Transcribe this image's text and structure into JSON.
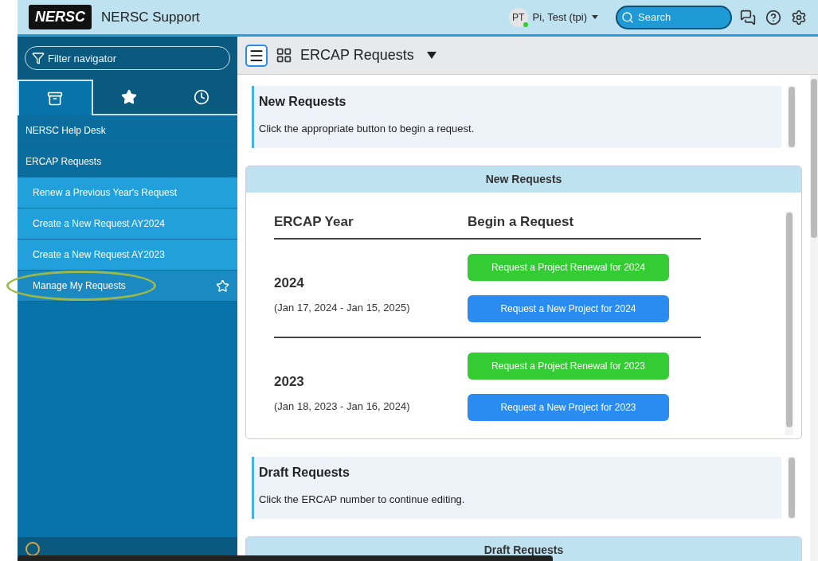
{
  "header": {
    "logo": "NERSC",
    "title": "NERSC Support",
    "user_initials": "PT",
    "user_name": "Pi, Test (tpi)",
    "search": {
      "placeholder": "Search"
    }
  },
  "sidebar": {
    "filter": {
      "placeholder": "Filter navigator"
    },
    "tabs": [
      {
        "kind": "archive",
        "selected": true
      },
      {
        "kind": "star",
        "selected": false
      },
      {
        "kind": "clock",
        "selected": false
      }
    ],
    "items": [
      {
        "label": "NERSC Help Desk",
        "kind": "group",
        "selected": false
      },
      {
        "label": "ERCAP Requests",
        "kind": "group",
        "selected": false
      },
      {
        "label": "Renew a Previous Year's Request",
        "kind": "link",
        "selected": false
      },
      {
        "label": "Create a New Request AY2024",
        "kind": "link",
        "selected": false
      },
      {
        "label": "Create a New Request AY2023",
        "kind": "link",
        "selected": false
      },
      {
        "label": "Manage My Requests",
        "kind": "link",
        "selected": true
      }
    ]
  },
  "toolbar": {
    "title": "ERCAP Requests"
  },
  "sections": [
    {
      "kind": "note",
      "title": "New Requests",
      "text": "Click the appropriate button to begin a request."
    },
    {
      "kind": "panel",
      "title": "New Requests",
      "columns": [
        "ERCAP Year",
        "Begin a Request"
      ],
      "rows": [
        {
          "year": "2024",
          "range": "(Jan 17, 2024 - Jan 15, 2025)",
          "buttons": [
            {
              "label": "Request a Project Renewal for 2024",
              "kind": "renew"
            },
            {
              "label": "Request a New Project for 2024",
              "kind": "new"
            }
          ]
        },
        {
          "year": "2023",
          "range": "(Jan 18, 2023 - Jan 16, 2024)",
          "buttons": [
            {
              "label": "Request a Project Renewal for 2023",
              "kind": "renew"
            },
            {
              "label": "Request a New Project for 2023",
              "kind": "new"
            }
          ]
        }
      ]
    },
    {
      "kind": "note",
      "title": "Draft Requests",
      "text": "Click the ERCAP number to continue editing."
    },
    {
      "kind": "panel",
      "title": "Draft Requests"
    }
  ]
}
